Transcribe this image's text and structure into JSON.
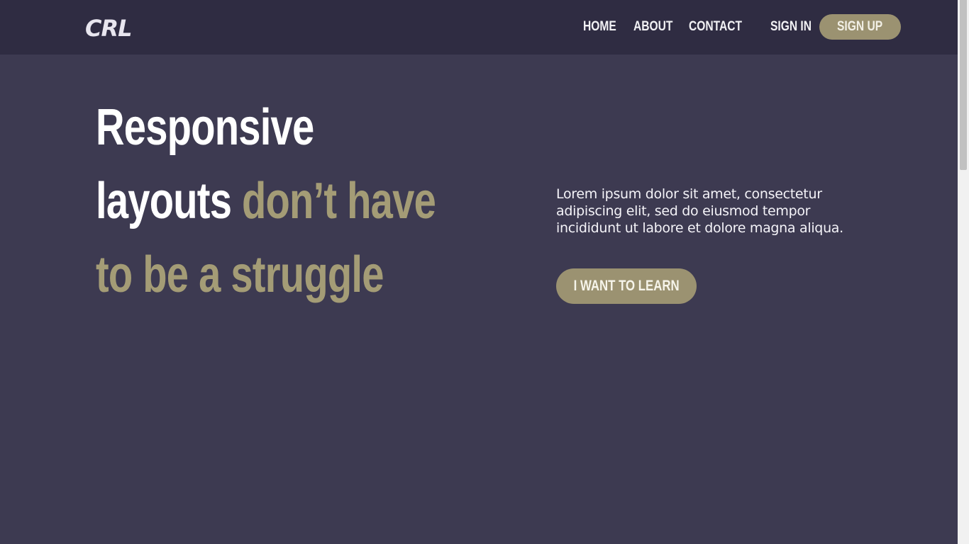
{
  "header": {
    "logo": "CRL",
    "nav": {
      "home": "HOME",
      "about": "ABOUT",
      "contact": "CONTACT",
      "sign_in": "SIGN IN",
      "sign_up": "SIGN UP"
    }
  },
  "hero": {
    "headline": {
      "line1": "Responsive",
      "line2_plain": "layouts",
      "line2_accent": "don’t have",
      "line3_accent": "to be a struggle"
    },
    "description": "Lorem ipsum dolor sit amet, consectetur adipiscing elit, sed do eiusmod tempor incididunt ut labore et dolore magna aliqua.",
    "cta_label": "I WANT TO LEARN"
  },
  "colors": {
    "background": "#3d3a51",
    "header_background": "#2f2c42",
    "accent": "#9b9271",
    "text": "#ffffff"
  }
}
